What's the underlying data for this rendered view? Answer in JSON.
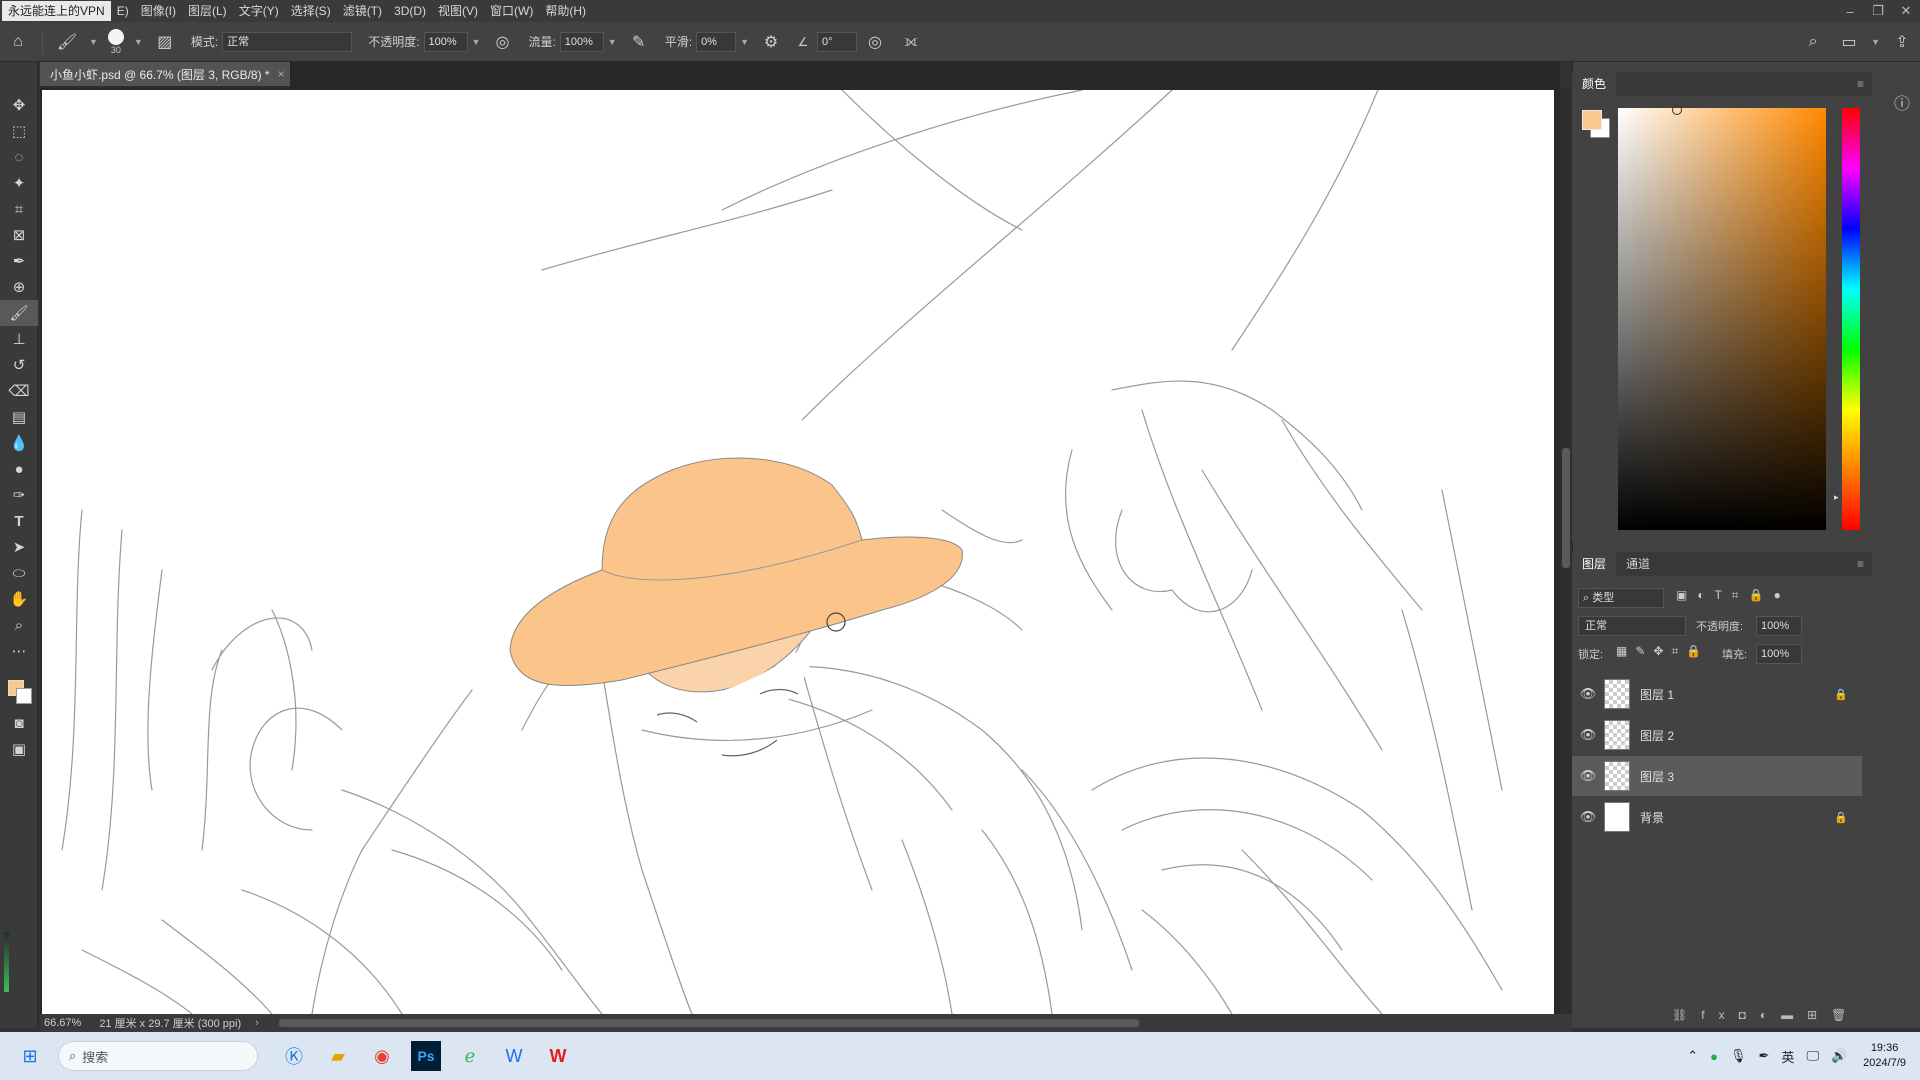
{
  "menubar": {
    "vpn_tag": "永远能连上的VPN",
    "items": [
      "E)",
      "图像(I)",
      "图层(L)",
      "文字(Y)",
      "选择(S)",
      "滤镜(T)",
      "3D(D)",
      "视图(V)",
      "窗口(W)",
      "帮助(H)"
    ]
  },
  "options": {
    "brush_size": "30",
    "mode_label": "模式:",
    "mode_value": "正常",
    "opacity_label": "不透明度:",
    "opacity_value": "100%",
    "flow_label": "流量:",
    "flow_value": "100%",
    "smooth_label": "平滑:",
    "smooth_value": "0%",
    "angle_value": "0°"
  },
  "document": {
    "tab_title": "小鱼小虾.psd @ 66.7% (图层 3, RGB/8) *",
    "tab_close": "×",
    "zoom": "66.67%",
    "doc_info": "21 厘米 x 29.7 厘米 (300 ppi)"
  },
  "color_panel": {
    "title": "颜色",
    "foreground": "#f9c98e",
    "background": "#ffffff"
  },
  "layers_panel": {
    "tabs": [
      "图层",
      "通道"
    ],
    "filter_label": "类型",
    "blend_mode": "正常",
    "opacity_label": "不透明度:",
    "opacity_value": "100%",
    "lock_label": "锁定:",
    "fill_label": "填充:",
    "fill_value": "100%",
    "layers": [
      {
        "name": "图层 1",
        "locked": true,
        "selected": false,
        "thumb": "transparent"
      },
      {
        "name": "图层 2",
        "locked": false,
        "selected": false,
        "thumb": "transparent"
      },
      {
        "name": "图层 3",
        "locked": false,
        "selected": true,
        "thumb": "transparent"
      },
      {
        "name": "背景",
        "locked": true,
        "selected": false,
        "thumb": "white"
      }
    ]
  },
  "taskbar": {
    "search_placeholder": "搜索",
    "time": "19:36",
    "date": "2024/7/9",
    "ime": "英"
  },
  "colors": {
    "hat": "#fbc48b",
    "face": "#fbd3ab",
    "accent_active": "#595959"
  }
}
